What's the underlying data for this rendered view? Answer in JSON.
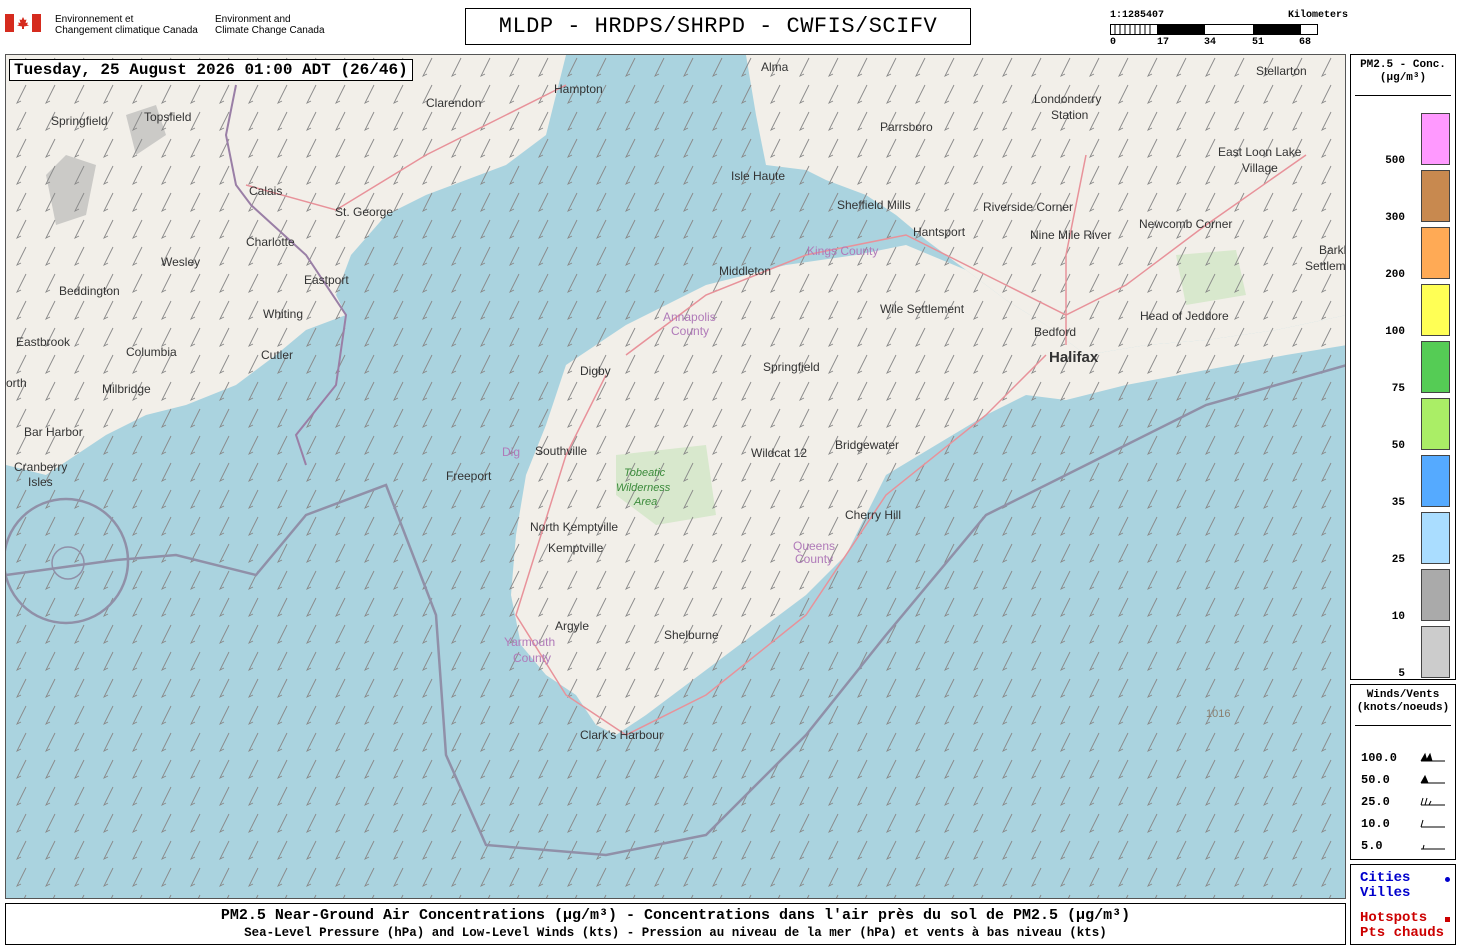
{
  "header": {
    "dept_fr_line1": "Environnement et",
    "dept_fr_line2": "Changement climatique Canada",
    "dept_en_line1": "Environment and",
    "dept_en_line2": "Climate Change Canada",
    "title": "MLDP - HRDPS/SHRPD - CWFIS/SCIFV"
  },
  "scale": {
    "ratio": "1:1285407",
    "unit": "Kilometers",
    "ticks": [
      "0",
      "17",
      "34",
      "51",
      "68"
    ]
  },
  "map": {
    "timestamp": "Tuesday, 25 August 2026 01:00 ADT (26/46)",
    "cities": [
      {
        "name": "Alma"
      },
      {
        "name": "Stellarton"
      },
      {
        "name": "Hampton"
      },
      {
        "name": "Clarendon"
      },
      {
        "name": "Londonderry"
      },
      {
        "name": "Station"
      },
      {
        "name": "Springfield"
      },
      {
        "name": "Topsfield"
      },
      {
        "name": "Parrsboro"
      },
      {
        "name": "East Loon Lake"
      },
      {
        "name": "Village"
      },
      {
        "name": "Isle Haute"
      },
      {
        "name": "Calais"
      },
      {
        "name": "St. George"
      },
      {
        "name": "Sheffield Mills"
      },
      {
        "name": "Riverside Corner"
      },
      {
        "name": "Newcomb Corner"
      },
      {
        "name": "Charlotte"
      },
      {
        "name": "Hantsport"
      },
      {
        "name": "Nine Mile River"
      },
      {
        "name": "Barkho"
      },
      {
        "name": "Wesley"
      },
      {
        "name": "Middleton"
      },
      {
        "name": "Settlem"
      },
      {
        "name": "Eastport"
      },
      {
        "name": "Beddington"
      },
      {
        "name": "Whiting"
      },
      {
        "name": "Wile Settlement"
      },
      {
        "name": "Head of Jeddore"
      },
      {
        "name": "Eastbrook"
      },
      {
        "name": "Bedford"
      },
      {
        "name": "Columbia"
      },
      {
        "name": "Cutler"
      },
      {
        "name": "Halifax"
      },
      {
        "name": "Springfield"
      },
      {
        "name": "Digby"
      },
      {
        "name": "orth"
      },
      {
        "name": "Milbridge"
      },
      {
        "name": "Bar Harbor"
      },
      {
        "name": "Bridgewater"
      },
      {
        "name": "Southville"
      },
      {
        "name": "Wildcat 12"
      },
      {
        "name": "Cranberry"
      },
      {
        "name": "Isles"
      },
      {
        "name": "Freeport"
      },
      {
        "name": "Cherry Hill"
      },
      {
        "name": "North Kemptville"
      },
      {
        "name": "Kemptville"
      },
      {
        "name": "Argyle"
      },
      {
        "name": "Shelburne"
      },
      {
        "name": "Clark's Harbour"
      }
    ],
    "counties": [
      "Kings County",
      "Annapolis",
      "County",
      "Queens",
      "County",
      "Yarmouth",
      "County",
      "Dig"
    ],
    "park": [
      "Tobeatic",
      "Wilderness",
      "Area"
    ],
    "isobar_label": "1016"
  },
  "pm_legend": {
    "title_line1": "PM2.5 - Conc.",
    "title_line2": "(µg/m³)",
    "levels": [
      {
        "label": "500",
        "color": "#ff99ff"
      },
      {
        "label": "300",
        "color": "#c8894f"
      },
      {
        "label": "200",
        "color": "#ffaa55"
      },
      {
        "label": "100",
        "color": "#ffff55"
      },
      {
        "label": "75",
        "color": "#55cc55"
      },
      {
        "label": "50",
        "color": "#aaee66"
      },
      {
        "label": "35",
        "color": "#55aaff"
      },
      {
        "label": "25",
        "color": "#aaddff"
      },
      {
        "label": "10",
        "color": "#aaaaaa"
      },
      {
        "label": "5",
        "color": "#cccccc"
      }
    ]
  },
  "wind_legend": {
    "title_line1": "Winds/Vents",
    "title_line2": "(knots/noeuds)",
    "speeds": [
      "100.0",
      "50.0",
      "25.0",
      "10.0",
      "5.0"
    ]
  },
  "cities_legend": {
    "cities": "Cities",
    "villes": "Villes",
    "hotspots": "Hotspots",
    "pts_chauds": "Pts chauds",
    "cities_color": "#0000cc",
    "hotspots_color": "#cc0000"
  },
  "footer": {
    "line1": "PM2.5 Near-Ground Air Concentrations (µg/m³) - Concentrations dans l'air près du sol de PM2.5 (µg/m³)",
    "line2": "Sea-Level Pressure (hPa) and Low-Level Winds (kts) - Pression au niveau de la mer (hPa) et vents à bas niveau (kts)"
  }
}
